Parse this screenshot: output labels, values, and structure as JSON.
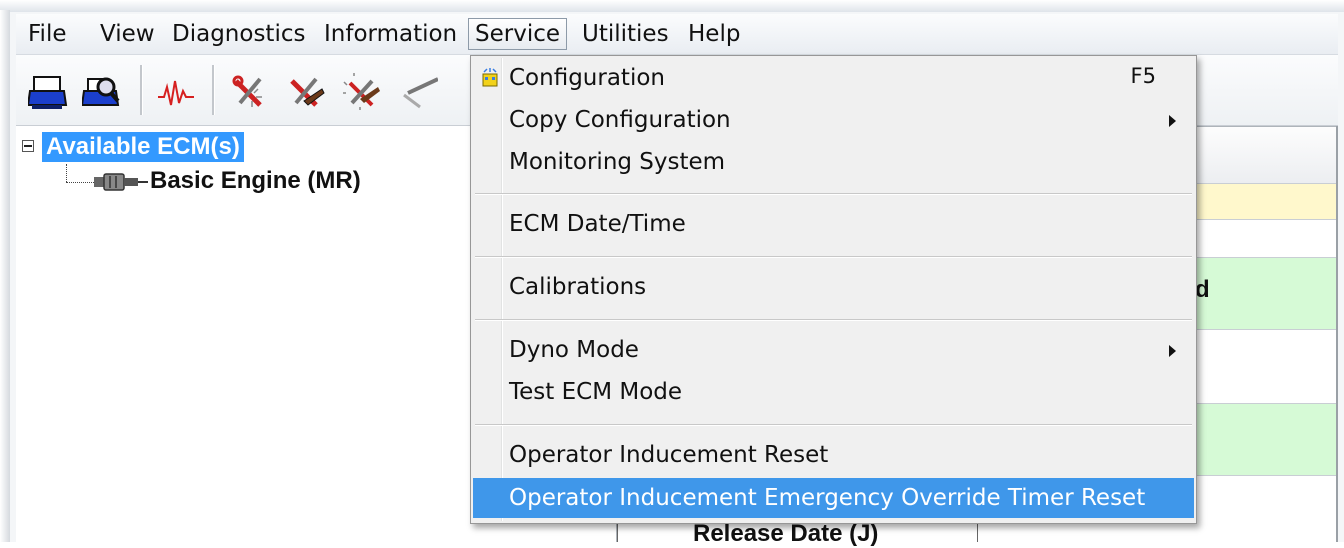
{
  "menubar": {
    "items": [
      "File",
      "View",
      "Diagnostics",
      "Information",
      "Service",
      "Utilities",
      "Help"
    ],
    "active": "Service"
  },
  "toolbar": {
    "icons": [
      "print-icon",
      "print-preview-icon",
      "waveform-icon",
      "tool-icon",
      "tool-edit-icon",
      "tool-sparkle-icon",
      "tool-partial-icon"
    ]
  },
  "tree": {
    "root_label": "Available ECM(s)",
    "child_label": "Basic Engine (MR)"
  },
  "right_pane": {
    "fragment_d": "d",
    "fragment_release": "Release Date (J)"
  },
  "service_menu": {
    "configuration": "Configuration",
    "configuration_shortcut": "F5",
    "copy_configuration": "Copy Configuration",
    "monitoring_system": "Monitoring System",
    "ecm_date_time": "ECM Date/Time",
    "calibrations": "Calibrations",
    "dyno_mode": "Dyno Mode",
    "test_ecm_mode": "Test ECM Mode",
    "operator_inducement_reset": "Operator Inducement Reset",
    "operator_inducement_override": "Operator Inducement Emergency Override Timer Reset"
  },
  "colors": {
    "selection": "#3399ff",
    "menu_highlight": "#3f97ea",
    "yellow_row": "#fff8cc",
    "green_row": "#d6fad6"
  }
}
